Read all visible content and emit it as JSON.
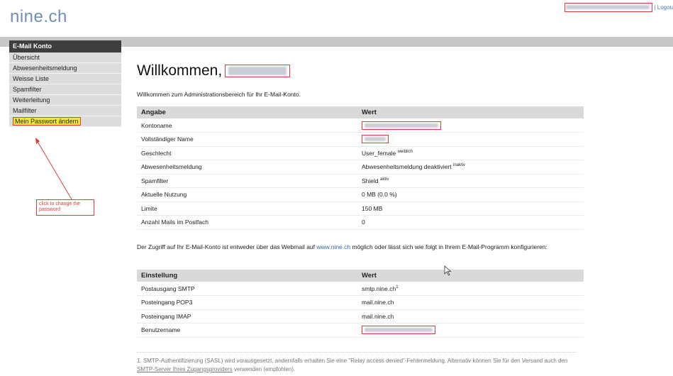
{
  "brand": {
    "logo": "nine.ch"
  },
  "topright": {
    "logout_label": "| Logou"
  },
  "sidebar": {
    "title": "E-Mail Konto",
    "items": [
      {
        "label": "Übersicht"
      },
      {
        "label": "Abwesenheitsmeldung"
      },
      {
        "label": "Weisse Liste"
      },
      {
        "label": "Spamfilter"
      },
      {
        "label": "Weiterleitung"
      },
      {
        "label": "Mailfilter"
      },
      {
        "label": "Mein Passwort ändern"
      }
    ]
  },
  "annotation": {
    "text": "click to change the password"
  },
  "main": {
    "welcome": "Willkommen,",
    "intro": "Willkommen zum Administrationsbereich für Ihr E-Mail-Konto.",
    "account_table": {
      "headers": [
        "Angabe",
        "Wert"
      ],
      "rows": [
        {
          "label": "Kontoname",
          "value": ""
        },
        {
          "label": "Vollständiger Name",
          "value": ""
        },
        {
          "label": "Geschlecht",
          "value": "User_female",
          "suffix": "weiblich"
        },
        {
          "label": "Abwesenheitsmeldung",
          "value": "Abwesenheitsmeldung deaktiviert",
          "suffix": "inaktiv"
        },
        {
          "label": "Spamfilter",
          "value": "Shield",
          "suffix": "aktiv"
        },
        {
          "label": "Aktuelle Nutzung",
          "value": "0 MB (0.0 %)"
        },
        {
          "label": "Limite",
          "value": "150 MB"
        },
        {
          "label": "Anzahl Mails im Postfach",
          "value": "0"
        }
      ]
    },
    "access_text_before": "Der Zugriff auf Ihr E-Mail-Konto ist entweder über das Webmail auf",
    "access_link": "www.nine.ch",
    "access_text_after": "möglich oder lässt sich wie folgt in Ihrem E-Mail-Programm konfigurieren:",
    "settings_table": {
      "headers": [
        "Einstellung",
        "Wert"
      ],
      "rows": [
        {
          "label": "Postausgang SMTP",
          "value": "smtp.nine.ch",
          "sup": "1"
        },
        {
          "label": "Posteingang POP3",
          "value": "mail.nine.ch"
        },
        {
          "label": "Posteingang IMAP",
          "value": "mail.nine.ch"
        },
        {
          "label": "Benutzername",
          "value": ""
        }
      ]
    },
    "footnote_before": "1. SMTP-Authentifizierung (SASL) wird vorausgesetzt, andernfalls erhalten Sie eine \"Relay access denied\"-Fehlermeldung. Alternativ können Sie für den Versand auch den",
    "footnote_link": "SMTP-Server Ihres Zugangsproviders",
    "footnote_after": "verwenden (empfohlen)."
  },
  "colors": {
    "accent": "#6e8fb7",
    "highlight": "#f3e83a",
    "annotation_red": "#e03b3b",
    "sidebar_header": "#3e3e3e"
  },
  "icons": {
    "cursor": "mouse-cursor-icon"
  }
}
